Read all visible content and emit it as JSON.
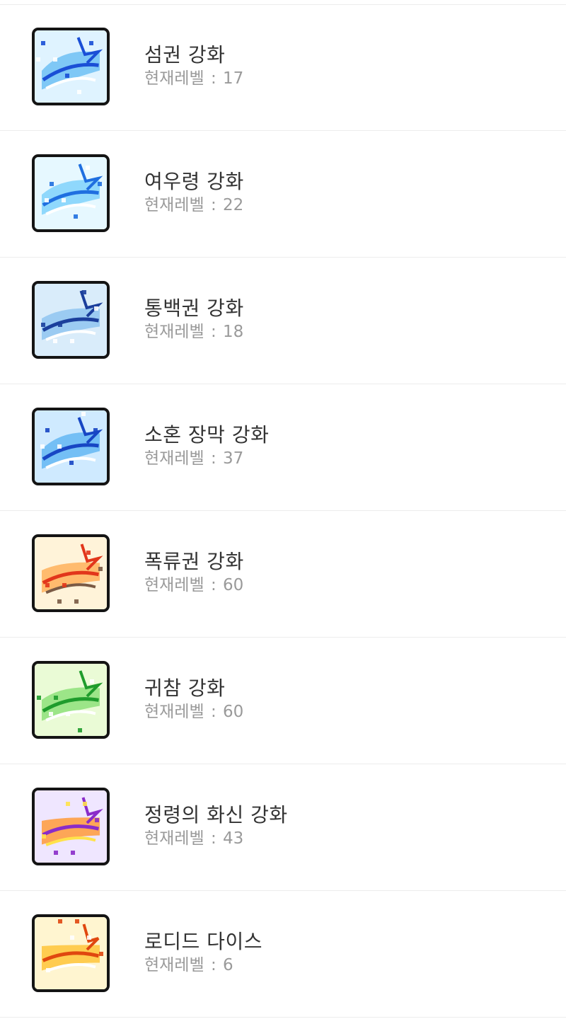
{
  "level_prefix": "현재레벨",
  "items": [
    {
      "name": "섬권 강화",
      "level": "17",
      "icon": "skill-icon-seomgwon",
      "colors": [
        "#dff3ff",
        "#6fbff5",
        "#1a4fd6",
        "#ffffff"
      ]
    },
    {
      "name": "여우령 강화",
      "level": "22",
      "icon": "skill-icon-fox-spirit",
      "colors": [
        "#e6f8ff",
        "#7fd2fb",
        "#1f6fe0",
        "#ffffff"
      ]
    },
    {
      "name": "통백권 강화",
      "level": "18",
      "icon": "skill-icon-tongbaekgwon",
      "colors": [
        "#d9ecfa",
        "#8fc6f0",
        "#1b3f9c",
        "#ffffff"
      ]
    },
    {
      "name": "소혼 장막 강화",
      "level": "37",
      "icon": "skill-icon-sohon-curtain",
      "colors": [
        "#cfeaff",
        "#64b7f3",
        "#1746c4",
        "#ffffff"
      ]
    },
    {
      "name": "폭류권 강화",
      "level": "60",
      "icon": "skill-icon-pokryugwon",
      "colors": [
        "#fff3d9",
        "#ffb05a",
        "#e2361b",
        "#7a5a44"
      ]
    },
    {
      "name": "귀참 강화",
      "level": "60",
      "icon": "skill-icon-gwicham",
      "colors": [
        "#eafbd6",
        "#8ee07a",
        "#1f9c2c",
        "#ffffff"
      ]
    },
    {
      "name": "정령의 화신 강화",
      "level": "43",
      "icon": "skill-icon-spirit-incarnation",
      "colors": [
        "#efe6ff",
        "#ff9a3a",
        "#8a2cc9",
        "#ffe24a"
      ]
    },
    {
      "name": "로디드 다이스",
      "level": "6",
      "icon": "skill-icon-loaded-dice",
      "colors": [
        "#fff5d0",
        "#ffc43a",
        "#e0470f",
        "#ffffff"
      ]
    }
  ]
}
